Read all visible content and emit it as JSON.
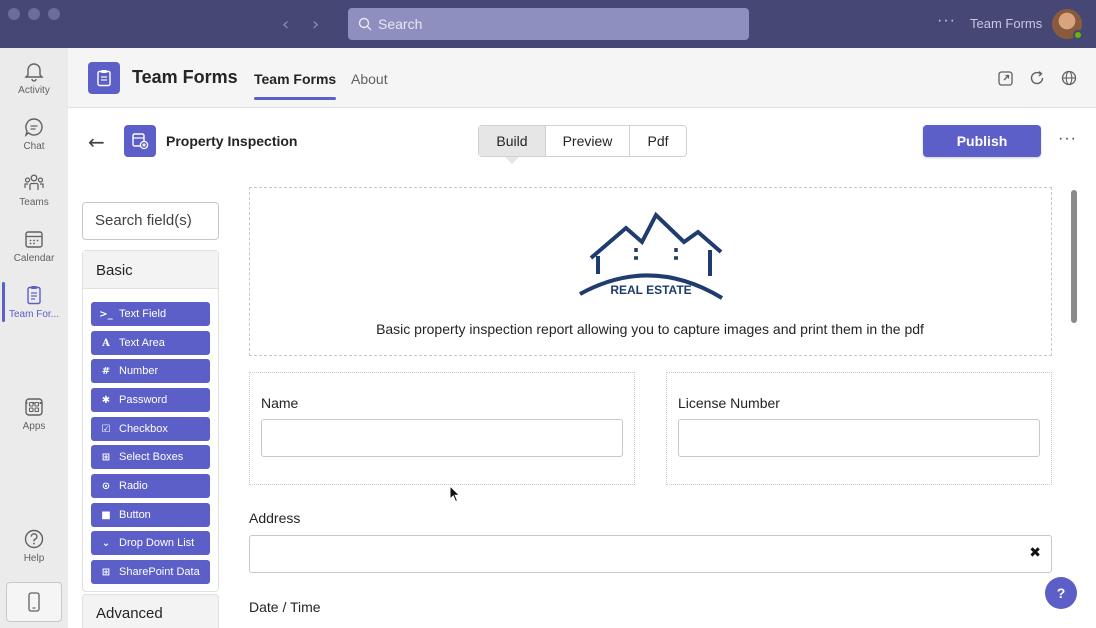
{
  "titlebar": {
    "search_placeholder": "Search",
    "more": "···",
    "app_name": "Team Forms"
  },
  "rail": {
    "items": [
      {
        "label": "Activity",
        "icon": "bell-icon"
      },
      {
        "label": "Chat",
        "icon": "chat-icon"
      },
      {
        "label": "Teams",
        "icon": "teams-icon"
      },
      {
        "label": "Calendar",
        "icon": "calendar-icon"
      },
      {
        "label": "Team For...",
        "icon": "forms-icon"
      },
      {
        "label": "Apps",
        "icon": "apps-icon"
      },
      {
        "label": "Help",
        "icon": "help-icon"
      }
    ],
    "more": "···"
  },
  "app_header": {
    "title": "Team Forms",
    "tabs": [
      {
        "label": "Team Forms"
      },
      {
        "label": "About"
      }
    ]
  },
  "form": {
    "title": "Property Inspection",
    "segments": [
      {
        "label": "Build"
      },
      {
        "label": "Preview"
      },
      {
        "label": "Pdf"
      }
    ],
    "publish_label": "Publish",
    "more": "···"
  },
  "palette": {
    "search_placeholder": "Search field(s)",
    "basic_label": "Basic",
    "advanced_label": "Advanced",
    "items": [
      {
        "label": "Text Field",
        "icon": ">_"
      },
      {
        "label": "Text Area",
        "icon": "A"
      },
      {
        "label": "Number",
        "icon": "#"
      },
      {
        "label": "Password",
        "icon": "✱"
      },
      {
        "label": "Checkbox",
        "icon": "☑"
      },
      {
        "label": "Select Boxes",
        "icon": "⊞"
      },
      {
        "label": "Radio",
        "icon": "⊙"
      },
      {
        "label": "Button",
        "icon": "■"
      },
      {
        "label": "Drop Down List",
        "icon": "⌄"
      },
      {
        "label": "SharePoint Data",
        "icon": "⊞"
      }
    ]
  },
  "canvas": {
    "logo_text": "REAL ESTATE",
    "description": "Basic property inspection report allowing you to capture images and print them in the pdf",
    "name_label": "Name",
    "license_label": "License Number",
    "address_label": "Address",
    "address_clear": "✖",
    "datetime_label": "Date / Time",
    "help": "?"
  },
  "colors": {
    "accent": "#5b5fc7",
    "titlebar": "#464775",
    "logo_navy": "#1e3c6e"
  }
}
